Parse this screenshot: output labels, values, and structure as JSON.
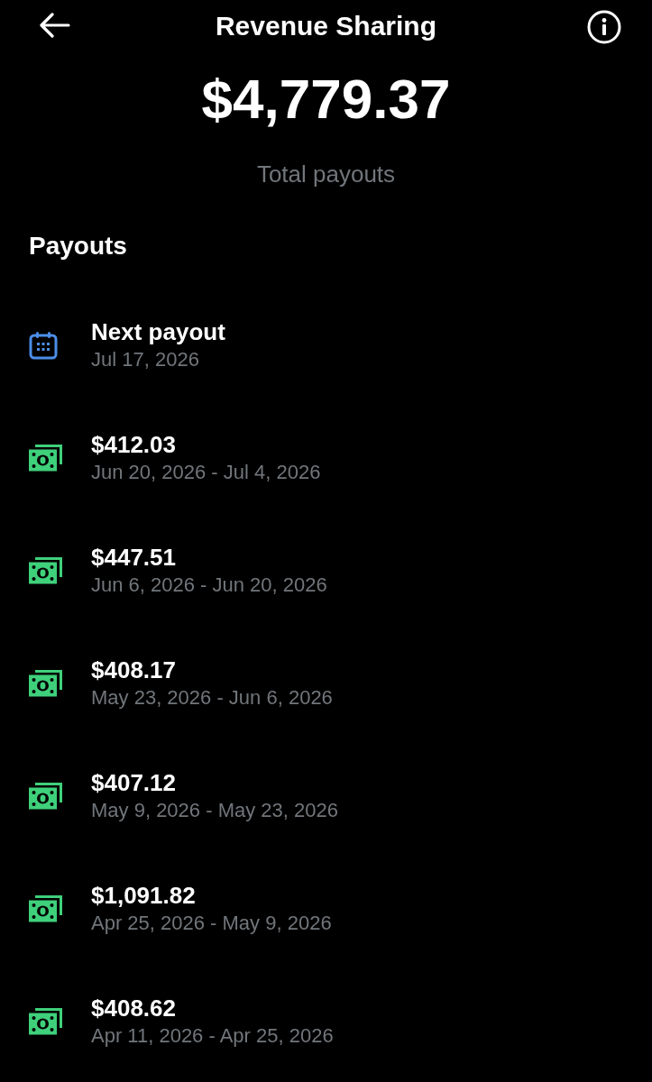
{
  "header": {
    "title": "Revenue Sharing"
  },
  "summary": {
    "amount": "$4,779.37",
    "label": "Total payouts"
  },
  "payouts": {
    "heading": "Payouts",
    "items": [
      {
        "kind": "scheduled",
        "title": "Next payout",
        "subtitle": "Jul 17, 2026"
      },
      {
        "kind": "paid",
        "title": "$412.03",
        "subtitle": "Jun 20, 2026 - Jul 4, 2026"
      },
      {
        "kind": "paid",
        "title": "$447.51",
        "subtitle": "Jun 6, 2026 - Jun 20, 2026"
      },
      {
        "kind": "paid",
        "title": "$408.17",
        "subtitle": "May 23, 2026 - Jun 6, 2026"
      },
      {
        "kind": "paid",
        "title": "$407.12",
        "subtitle": "May 9, 2026 - May 23, 2026"
      },
      {
        "kind": "paid",
        "title": "$1,091.82",
        "subtitle": "Apr 25, 2026 - May 9, 2026"
      },
      {
        "kind": "paid",
        "title": "$408.62",
        "subtitle": "Apr 11, 2026 - Apr 25, 2026"
      }
    ]
  }
}
